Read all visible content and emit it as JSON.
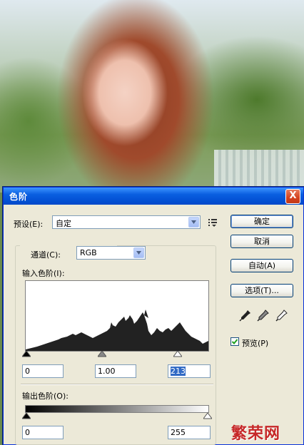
{
  "dialog": {
    "title": "色阶",
    "close_label": "X"
  },
  "preset": {
    "label": "预设(E):",
    "value": "自定"
  },
  "channel": {
    "label": "通道(C):",
    "value": "RGB"
  },
  "input_levels": {
    "label": "输入色阶(I):",
    "black": "0",
    "gamma": "1.00",
    "white": "213"
  },
  "output_levels": {
    "label": "输出色阶(O):",
    "black": "0",
    "white": "255"
  },
  "buttons": {
    "ok": "确定",
    "cancel": "取消",
    "auto": "自动(A)",
    "options": "选项(T)..."
  },
  "preview": {
    "label": "预览(P)",
    "checked": true
  },
  "watermark": {
    "site": "繁荣网"
  },
  "icons": {
    "menu": "list-menu-icon",
    "dropdown": "chevron-down-icon",
    "eyedroppers": [
      "black-eyedropper-icon",
      "gray-eyedropper-icon",
      "white-eyedropper-icon"
    ]
  }
}
